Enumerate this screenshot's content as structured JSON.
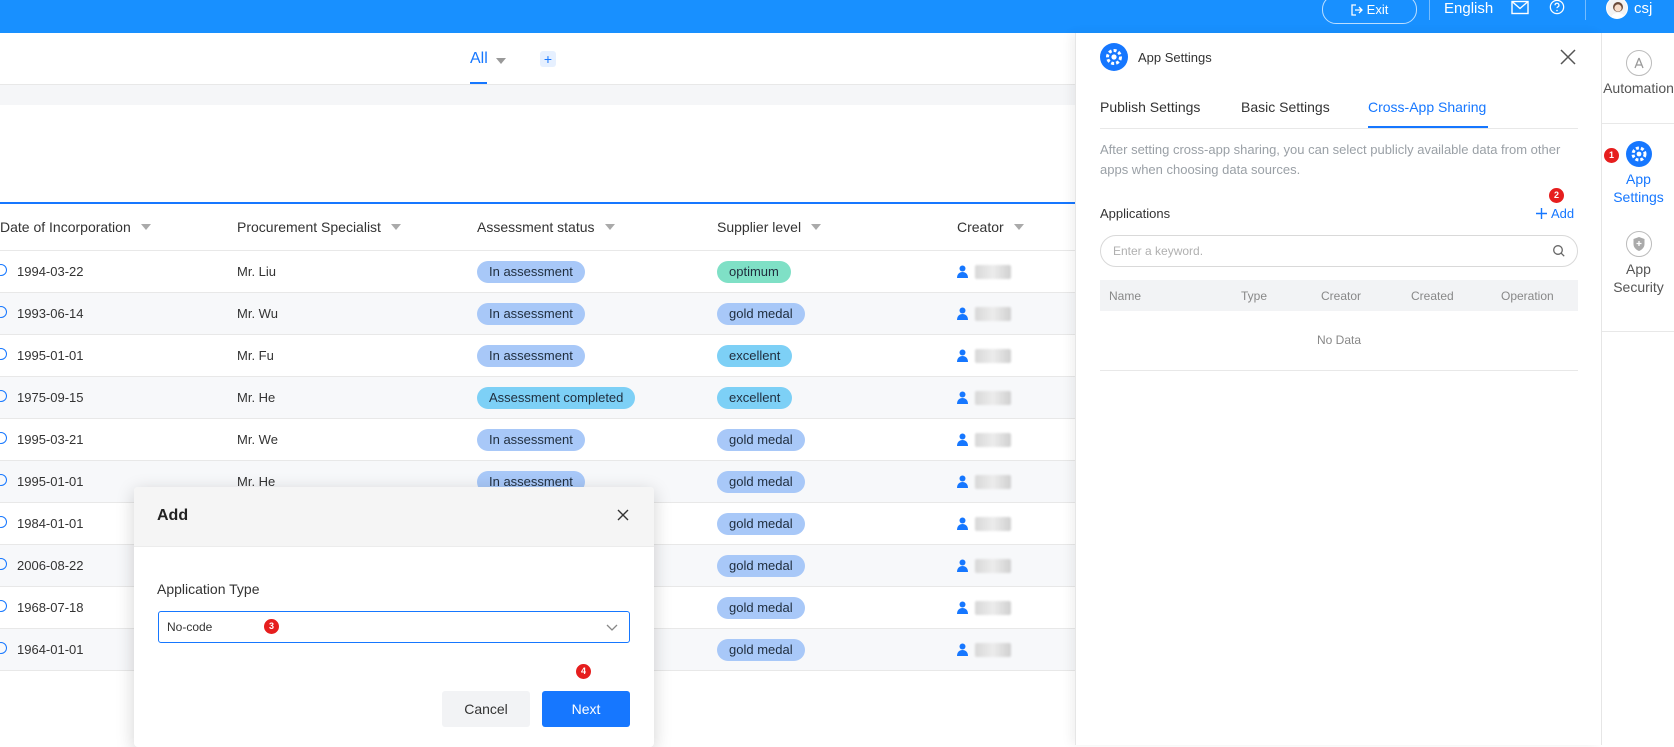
{
  "topbar": {
    "exit_label": "Exit",
    "language": "English",
    "username": "csj",
    "mail_icon": "mail-icon",
    "help_icon": "help-icon"
  },
  "views": {
    "current": "All"
  },
  "table": {
    "columns": [
      "Date of Incorporation",
      "Procurement Specialist",
      "Assessment status",
      "Supplier level",
      "Creator"
    ],
    "rows": [
      {
        "date": "1994-03-22",
        "specialist": "Mr. Liu",
        "status": "In assessment",
        "level": "optimum"
      },
      {
        "date": "1993-06-14",
        "specialist": "Mr. Wu",
        "status": "In assessment",
        "level": "gold medal"
      },
      {
        "date": "1995-01-01",
        "specialist": "Mr. Fu",
        "status": "In assessment",
        "level": "excellent"
      },
      {
        "date": "1975-09-15",
        "specialist": "Mr. He",
        "status": "Assessment completed",
        "level": "excellent"
      },
      {
        "date": "1995-03-21",
        "specialist": "Mr. We",
        "status": "In assessment",
        "level": "gold medal"
      },
      {
        "date": "1995-01-01",
        "specialist": "Mr. He",
        "status": "In assessment",
        "level": "gold medal"
      },
      {
        "date": "1984-01-01",
        "specialist": "",
        "status": "",
        "level": "gold medal"
      },
      {
        "date": "2006-08-22",
        "specialist": "",
        "status": "",
        "level": "gold medal"
      },
      {
        "date": "1968-07-18",
        "specialist": "",
        "status": "",
        "level": "gold medal"
      },
      {
        "date": "1964-01-01",
        "specialist": "",
        "status": "",
        "level": "gold medal"
      }
    ]
  },
  "modal": {
    "title": "Add",
    "field_label": "Application Type",
    "field_value": "No-code",
    "cancel_label": "Cancel",
    "next_label": "Next"
  },
  "panel": {
    "title": "App Settings",
    "tabs": [
      "Publish Settings",
      "Basic Settings",
      "Cross-App Sharing"
    ],
    "active_tab": "Cross-App Sharing",
    "description": "After setting cross-app sharing, you can select publicly available data from other apps when choosing data sources.",
    "applications_label": "Applications",
    "add_label": "Add",
    "search_placeholder": "Enter a keyword.",
    "table_columns": [
      "Name",
      "Type",
      "Creator",
      "Created",
      "Operation"
    ],
    "empty_text": "No Data"
  },
  "rail": {
    "items": [
      {
        "label": "Automation",
        "icon": "automation-icon"
      },
      {
        "label": "App Settings",
        "icon": "gear-icon",
        "active": true
      },
      {
        "label": "App Security",
        "icon": "shield-icon"
      }
    ]
  },
  "steps": [
    "1",
    "2",
    "3",
    "4"
  ],
  "colors": {
    "accent": "#1677ff",
    "topbar": "#1890ff",
    "step_badge": "#e61e1e"
  }
}
